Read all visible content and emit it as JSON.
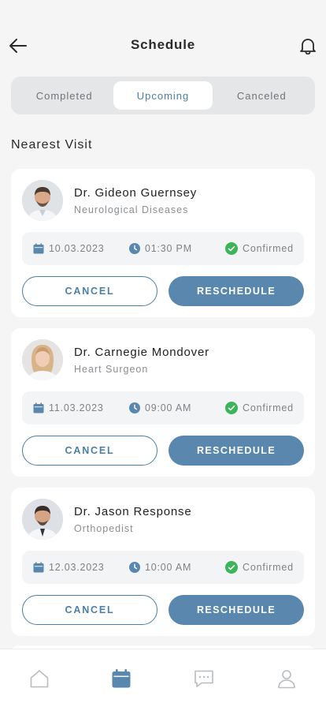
{
  "header": {
    "title": "Schedule",
    "back_icon": "arrow-left-icon",
    "bell_icon": "bell-icon"
  },
  "tabs": [
    {
      "label": "Completed",
      "active": false
    },
    {
      "label": "Upcoming",
      "active": true
    },
    {
      "label": "Canceled",
      "active": false
    }
  ],
  "section_title": "Nearest Visit",
  "appointments": [
    {
      "doctor": "Dr. Gideon Guernsey",
      "specialty": "Neurological Diseases",
      "date": "10.03.2023",
      "time": "01:30 PM",
      "status": "Confirmed",
      "cancel_label": "CANCEL",
      "reschedule_label": "RESCHEDULE"
    },
    {
      "doctor": "Dr. Carnegie Mondover",
      "specialty": "Heart Surgeon",
      "date": "11.03.2023",
      "time": "09:00 AM",
      "status": "Confirmed",
      "cancel_label": "CANCEL",
      "reschedule_label": "RESCHEDULE"
    },
    {
      "doctor": "Dr. Jason Response",
      "specialty": "Orthopedist",
      "date": "12.03.2023",
      "time": "10:00 AM",
      "status": "Confirmed",
      "cancel_label": "CANCEL",
      "reschedule_label": "RESCHEDULE"
    }
  ],
  "colors": {
    "accent": "#5a87ad",
    "tab_active_text": "#4a7fa7",
    "status_green": "#3cb55a",
    "background": "#f5f5f5"
  },
  "bottom_nav": [
    {
      "icon": "home-icon",
      "active": false
    },
    {
      "icon": "calendar-icon",
      "active": true
    },
    {
      "icon": "chat-icon",
      "active": false
    },
    {
      "icon": "profile-icon",
      "active": false
    }
  ]
}
